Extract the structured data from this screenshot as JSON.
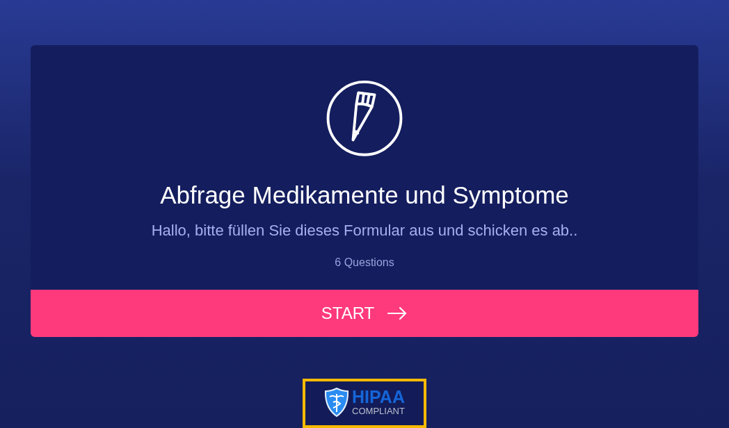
{
  "form": {
    "title": "Abfrage Medikamente und Symptome",
    "description": "Hallo, bitte füllen Sie dieses Formular aus und schicken es ab..",
    "question_count": "6 Questions",
    "start_button": "START"
  },
  "badge": {
    "title": "HIPAA",
    "subtitle": "COMPLIANT"
  }
}
